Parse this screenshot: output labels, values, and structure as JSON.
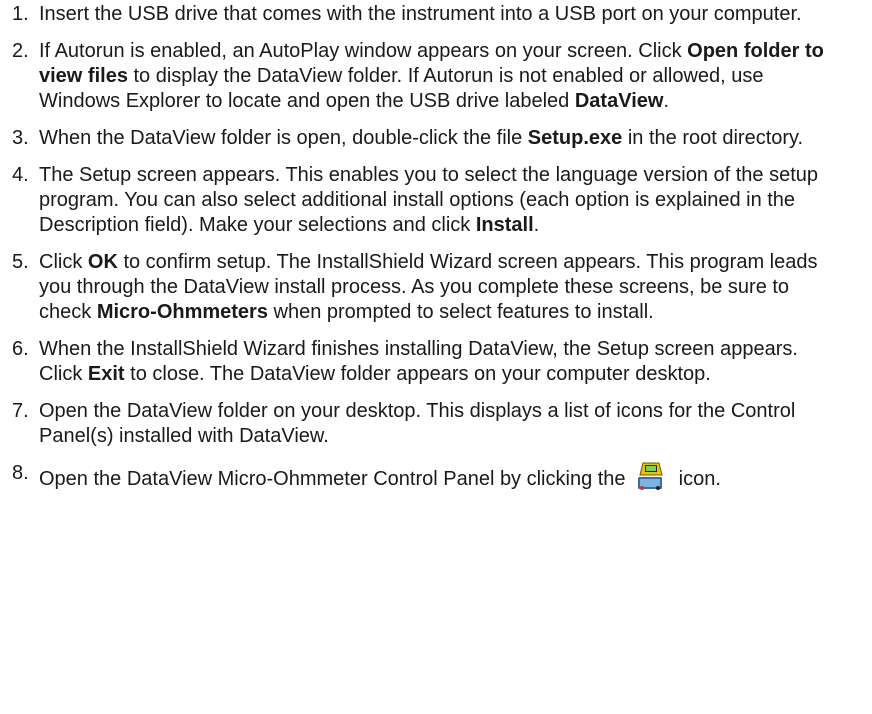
{
  "steps": [
    {
      "num": "1.",
      "parts": [
        {
          "text": "Insert the USB drive that comes with the instrument into a USB port on your computer.",
          "bold": false
        }
      ]
    },
    {
      "num": "2.",
      "parts": [
        {
          "text": "If Autorun is enabled, an AutoPlay window appears on your screen. Click ",
          "bold": false
        },
        {
          "text": "Open folder to view files",
          "bold": true
        },
        {
          "text": " to display the DataView folder. If Autorun is not enabled or allowed, use Windows Explorer to locate and open the USB drive labeled ",
          "bold": false
        },
        {
          "text": "DataView",
          "bold": true
        },
        {
          "text": ".",
          "bold": false
        }
      ]
    },
    {
      "num": "3.",
      "parts": [
        {
          "text": "When the DataView folder is open, double-click the file ",
          "bold": false
        },
        {
          "text": "Setup.exe",
          "bold": true
        },
        {
          "text": " in the root directory.",
          "bold": false
        }
      ]
    },
    {
      "num": "4.",
      "parts": [
        {
          "text": "The Setup screen appears. This enables you to select the language version of the setup program. You can also select additional install options (each option is explained in the Description field). Make your selections and click ",
          "bold": false
        },
        {
          "text": "Install",
          "bold": true
        },
        {
          "text": ".",
          "bold": false
        }
      ]
    },
    {
      "num": "5.",
      "parts": [
        {
          "text": "Click ",
          "bold": false
        },
        {
          "text": "OK",
          "bold": true
        },
        {
          "text": " to confirm setup. The InstallShield Wizard screen appears. This program leads you through the DataView install process. As you complete these screens, be sure to check ",
          "bold": false
        },
        {
          "text": "Micro-Ohmmeters",
          "bold": true
        },
        {
          "text": " when prompted to select features to install.",
          "bold": false
        }
      ]
    },
    {
      "num": "6.",
      "parts": [
        {
          "text": "When the InstallShield Wizard finishes installing DataView, the Setup screen appears. Click ",
          "bold": false
        },
        {
          "text": "Exit",
          "bold": true
        },
        {
          "text": " to close. The DataView folder appears on your computer desktop.",
          "bold": false
        }
      ]
    },
    {
      "num": "7.",
      "parts": [
        {
          "text": "Open the DataView folder on your desktop. This displays a list of icons for the Control Panel(s) installed with DataView.",
          "bold": false
        }
      ]
    },
    {
      "num": "8.",
      "parts": [
        {
          "text": "Open the DataView Micro-Ohmmeter Control Panel by clicking the ",
          "bold": false
        },
        {
          "icon": "control-panel-icon"
        },
        {
          "text": " icon.",
          "bold": false
        }
      ]
    }
  ]
}
